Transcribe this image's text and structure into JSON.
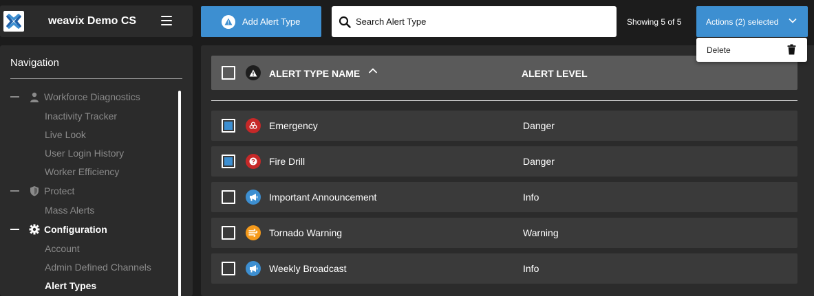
{
  "brand": {
    "name": "weavix Demo CS"
  },
  "nav": {
    "title": "Navigation",
    "groups": [
      {
        "label": "Workforce Diagnostics",
        "icon": "person-icon",
        "items": [
          "Inactivity Tracker",
          "Live Look",
          "User Login History",
          "Worker Efficiency"
        ]
      },
      {
        "label": "Protect",
        "icon": "shield-icon",
        "items": [
          "Mass Alerts"
        ]
      },
      {
        "label": "Configuration",
        "icon": "gear-icon",
        "items": [
          "Account",
          "Admin Defined Channels",
          "Alert Types"
        ]
      }
    ],
    "active_group": "Configuration",
    "active_item": "Alert Types"
  },
  "toolbar": {
    "add_label": "Add Alert Type",
    "search_placeholder": "Search Alert Type",
    "search_value": "",
    "showing": "Showing 5 of 5",
    "actions_label": "Actions (2) selected"
  },
  "menu": {
    "delete_label": "Delete"
  },
  "table": {
    "columns": [
      "ALERT TYPE NAME",
      "ALERT LEVEL"
    ],
    "sort": "ascending",
    "rows": [
      {
        "name": "Emergency",
        "level": "Danger",
        "checked": true,
        "icon": "biohazard-icon",
        "color": "#c62828"
      },
      {
        "name": "Fire Drill",
        "level": "Danger",
        "checked": true,
        "icon": "question-icon",
        "color": "#c62828"
      },
      {
        "name": "Important Announcement",
        "level": "Info",
        "checked": false,
        "icon": "megaphone-icon",
        "color": "#3d8fd1"
      },
      {
        "name": "Tornado Warning",
        "level": "Warning",
        "checked": false,
        "icon": "wind-icon",
        "color": "#f59a1b"
      },
      {
        "name": "Weekly Broadcast",
        "level": "Info",
        "checked": false,
        "icon": "megaphone-icon",
        "color": "#3d8fd1"
      }
    ]
  },
  "colors": {
    "accent": "#3d8fd1",
    "danger": "#c62828",
    "warning": "#f59a1b",
    "panel": "#2b2b2b",
    "row": "#3a3a3a",
    "header": "#5a5a5a"
  }
}
